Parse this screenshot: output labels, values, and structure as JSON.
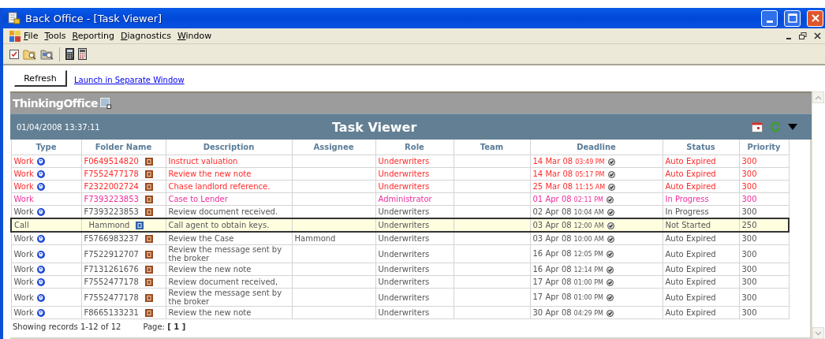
{
  "window": {
    "title": "Back Office - [Task Viewer]"
  },
  "menu": [
    {
      "label": "File"
    },
    {
      "label": "Tools"
    },
    {
      "label": "Reporting"
    },
    {
      "label": "Diagnostics"
    },
    {
      "label": "Window"
    }
  ],
  "actions": {
    "refresh": "Refresh",
    "link": "Launch in Separate Window"
  },
  "brand": "ThinkingOffice",
  "viewer": {
    "datetime": "01/04/2008 13:37:11",
    "title": "Task Viewer"
  },
  "table": {
    "columns": [
      "Type",
      "Folder Name",
      "Description",
      "Assignee",
      "Role",
      "Team",
      "Deadline",
      "Status",
      "Priority"
    ],
    "rows": [
      {
        "type": "Work",
        "type_icon": true,
        "folder": "F0649514820",
        "kind": "work",
        "description": "Instruct valuation",
        "role": "Underwriters",
        "deadline_date": "14 Mar 08",
        "deadline_time": "03:49 PM",
        "status": "Auto Expired",
        "priority": "300",
        "color": "#ff2a2a",
        "selected": false
      },
      {
        "type": "Work",
        "type_icon": true,
        "folder": "F7552477178",
        "kind": "work",
        "description": "Review the new note",
        "role": "Underwriters",
        "deadline_date": "14 Mar 08",
        "deadline_time": "05:17 PM",
        "status": "Auto Expired",
        "priority": "300",
        "color": "#ff2a2a",
        "selected": false
      },
      {
        "type": "Work",
        "type_icon": true,
        "folder": "F2322002724",
        "kind": "work",
        "description": "Chase landlord reference.",
        "role": "Underwriters",
        "deadline_date": "25 Mar 08",
        "deadline_time": "11:15 AM",
        "status": "Auto Expired",
        "priority": "300",
        "color": "#ff2a2a",
        "selected": false
      },
      {
        "type": "Work",
        "type_icon": false,
        "folder": "F7393223853",
        "kind": "work",
        "description": "Case to Lender",
        "role": "Administrator",
        "deadline_date": "01 Apr 08",
        "deadline_time": "02:11 PM",
        "status": "In Progress",
        "priority": "300",
        "color": "#f02c9c",
        "selected": false
      },
      {
        "type": "Work",
        "type_icon": true,
        "folder": "F7393223853",
        "kind": "work",
        "description": "Review document received.",
        "role": "Underwriters",
        "deadline_date": "02 Apr 08",
        "deadline_time": "10:04 AM",
        "status": "In Progress",
        "priority": "300",
        "color": "#555555",
        "selected": false
      },
      {
        "type": "Call",
        "type_icon": false,
        "folder": "Hammond",
        "kind": "call",
        "description": "Call agent to obtain keys.",
        "role": "Underwriters",
        "deadline_date": "03 Apr 08",
        "deadline_time": "12:00 AM",
        "status": "Not Started",
        "priority": "250",
        "color": "#555555",
        "selected": true
      },
      {
        "type": "Work",
        "type_icon": true,
        "folder": "F5766983237",
        "kind": "work",
        "description": "Review the Case",
        "assignee": "Hammond",
        "role": "Underwriters",
        "deadline_date": "03 Apr 08",
        "deadline_time": "10:00 AM",
        "status": "Auto Expired",
        "priority": "300",
        "color": "#555555",
        "selected": false
      },
      {
        "type": "Work",
        "type_icon": true,
        "folder": "F7522912707",
        "kind": "work",
        "description": "Review the message sent by the broker",
        "role": "Underwriters",
        "deadline_date": "16 Apr 08",
        "deadline_time": "12:05 PM",
        "status": "Auto Expired",
        "priority": "300",
        "color": "#555555",
        "selected": false
      },
      {
        "type": "Work",
        "type_icon": true,
        "folder": "F7131261676",
        "kind": "work",
        "description": "Review the new note",
        "role": "Underwriters",
        "deadline_date": "16 Apr 08",
        "deadline_time": "12:14 PM",
        "status": "Auto Expired",
        "priority": "300",
        "color": "#555555",
        "selected": false
      },
      {
        "type": "Work",
        "type_icon": true,
        "folder": "F7552477178",
        "kind": "work",
        "description": "Review document received,",
        "role": "Underwriters",
        "deadline_date": "17 Apr 08",
        "deadline_time": "01:00 PM",
        "status": "Auto Expired",
        "priority": "300",
        "color": "#555555",
        "selected": false
      },
      {
        "type": "Work",
        "type_icon": true,
        "folder": "F7552477178",
        "kind": "work",
        "description": "Review the message sent by the broker",
        "role": "Underwriters",
        "deadline_date": "17 Apr 08",
        "deadline_time": "01:00 PM",
        "status": "Auto Expired",
        "priority": "300",
        "color": "#555555",
        "selected": false
      },
      {
        "type": "Work",
        "type_icon": true,
        "folder": "F8665133231",
        "kind": "work",
        "description": "Review the new note",
        "role": "Underwriters",
        "deadline_date": "30 Apr 08",
        "deadline_time": "04:29 PM",
        "status": "Auto Expired",
        "priority": "300",
        "color": "#555555",
        "selected": false
      }
    ]
  },
  "footer": {
    "records": "Showing records 1-12 of 12",
    "page_label": "Page:",
    "page": "[ 1 ]"
  }
}
